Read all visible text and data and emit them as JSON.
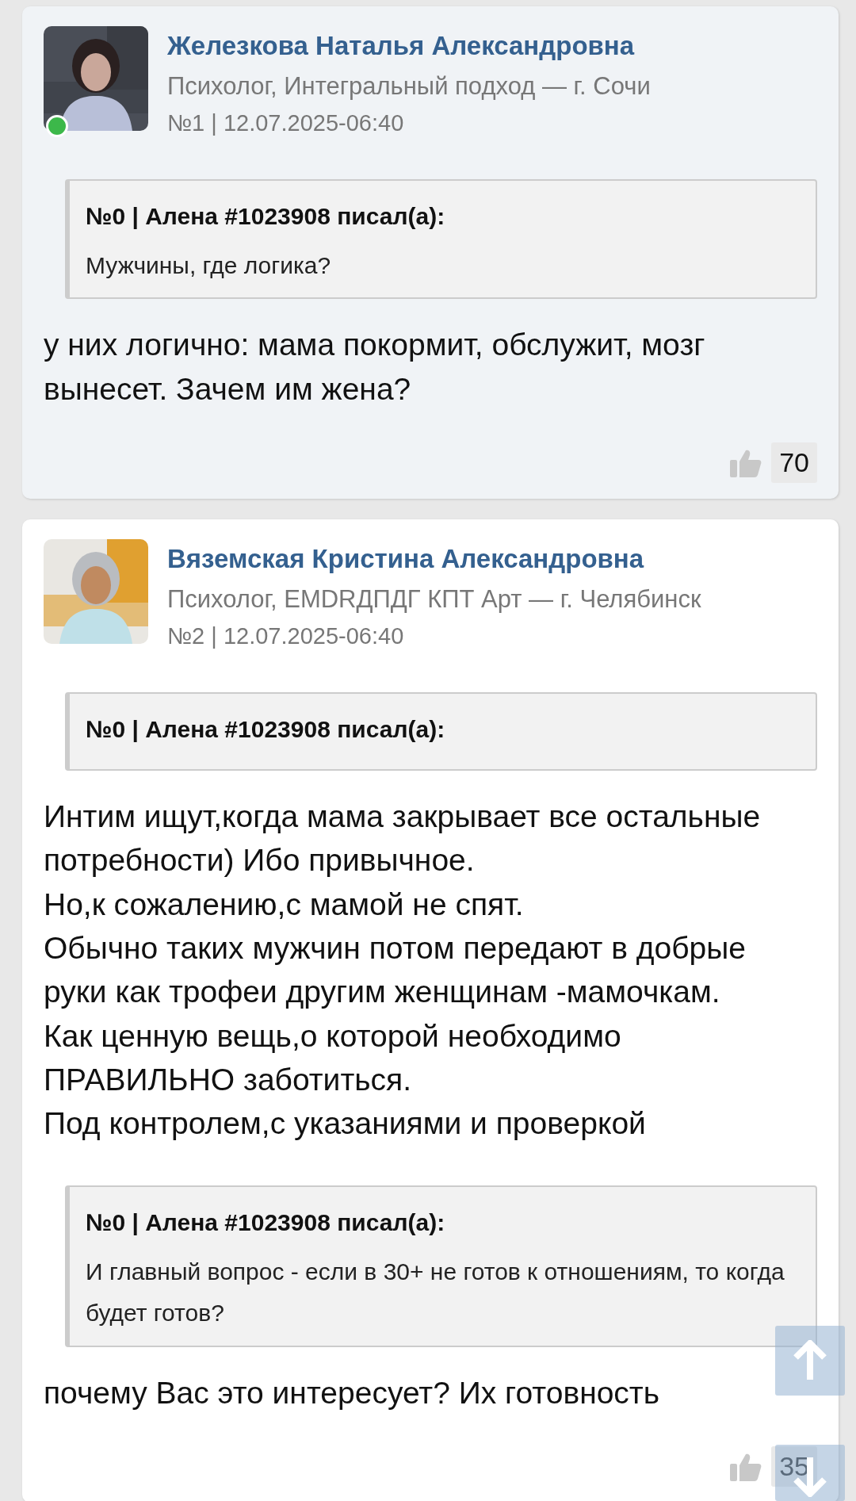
{
  "posts": [
    {
      "author": "Железкова Наталья Александровна",
      "subtitle": "Психолог, Интегральный подход — г. Сочи",
      "meta": "№1 | 12.07.2025-06:40",
      "online": true,
      "highlighted": true,
      "blocks": [
        {
          "kind": "quote",
          "header": "№0 | Алена #1023908 писал(а):",
          "text": "Мужчины, где логика?"
        },
        {
          "kind": "text",
          "text": "у них логично: мама покормит, обслужит, мозг вынесет. Зачем им жена?"
        }
      ],
      "likes": "70"
    },
    {
      "author": "Вяземская Кристина Александровна",
      "subtitle": "Психолог, EMDRДПДГ КПТ Арт — г. Челябинск",
      "meta": "№2 | 12.07.2025-06:40",
      "online": false,
      "highlighted": false,
      "blocks": [
        {
          "kind": "quote",
          "header": "№0 | Алена #1023908 писал(а):"
        },
        {
          "kind": "text",
          "text": "Интим ищут,когда мама закрывает все остальные потребности) Ибо привычное.\nНо,к сожалению,с мамой не спят.\nОбычно таких мужчин потом передают в добрые руки как трофеи другим женщинам -мамочкам.\nКак ценную вещь,о которой необходимо ПРАВИЛЬНО заботиться.\nПод контролем,с указаниями и проверкой"
        },
        {
          "kind": "quote",
          "header": "№0 | Алена #1023908 писал(а):",
          "text": "И главный вопрос - если в 30+ не готов к отношениям, то когда будет готов?"
        },
        {
          "kind": "text",
          "text": "почему Вас это интересует? Их готовность"
        }
      ],
      "likes": "35"
    }
  ]
}
